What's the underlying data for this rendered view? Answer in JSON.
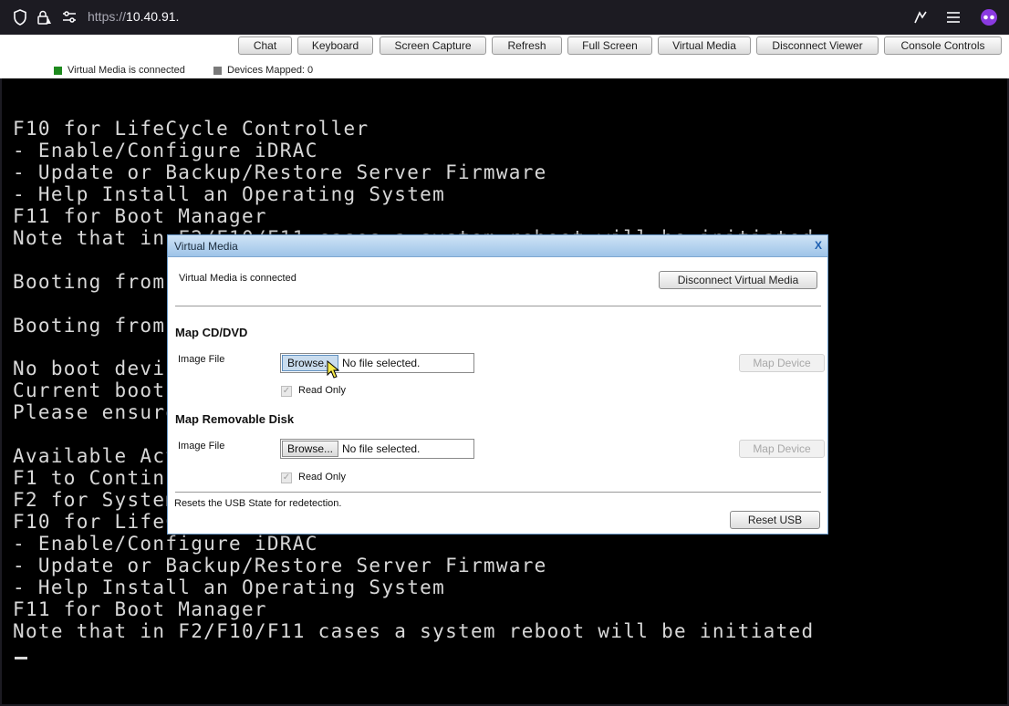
{
  "browser": {
    "url_main": "https://",
    "url_host": "10.40.91."
  },
  "toolbar": {
    "buttons": [
      "Chat",
      "Keyboard",
      "Screen Capture",
      "Refresh",
      "Full Screen",
      "Virtual Media",
      "Disconnect Viewer",
      "Console Controls"
    ],
    "status_connected": "Virtual Media is connected",
    "status_devices": "Devices Mapped: 0",
    "colors": {
      "connected": "#1e8a1e",
      "devices": "#7a7a7a"
    }
  },
  "console": {
    "lines": [
      "F10 for LifeCycle Controller",
      "- Enable/Configure iDRAC",
      "- Update or Backup/Restore Server Firmware",
      "- Help Install an Operating System",
      "F11 for Boot Manager",
      "Note that in F2/F10/F11 cases a system reboot will be initiated",
      "",
      "Booting from",
      "",
      "Booting from",
      "",
      "No boot devic",
      "Current boot",
      "Please ensure",
      "",
      "Available Act",
      "F1 to Continu",
      "F2 for System",
      "F10 for LifeC",
      "- Enable/Configure iDRAC",
      "- Update or Backup/Restore Server Firmware",
      "- Help Install an Operating System",
      "F11 for Boot Manager",
      "Note that in F2/F10/F11 cases a system reboot will be initiated"
    ]
  },
  "dialog": {
    "title": "Virtual Media",
    "close": "X",
    "connected_text": "Virtual Media is connected",
    "disconnect_button": "Disconnect Virtual Media",
    "cd": {
      "heading": "Map CD/DVD",
      "image_label": "Image File",
      "browse": "Browse...",
      "file": "No file selected.",
      "read_only": "Read Only",
      "map_button": "Map Device"
    },
    "removable": {
      "heading": "Map Removable Disk",
      "image_label": "Image File",
      "browse": "Browse...",
      "file": "No file selected.",
      "read_only": "Read Only",
      "map_button": "Map Device"
    },
    "reset_text": "Resets the USB State for redetection.",
    "reset_button": "Reset USB"
  }
}
